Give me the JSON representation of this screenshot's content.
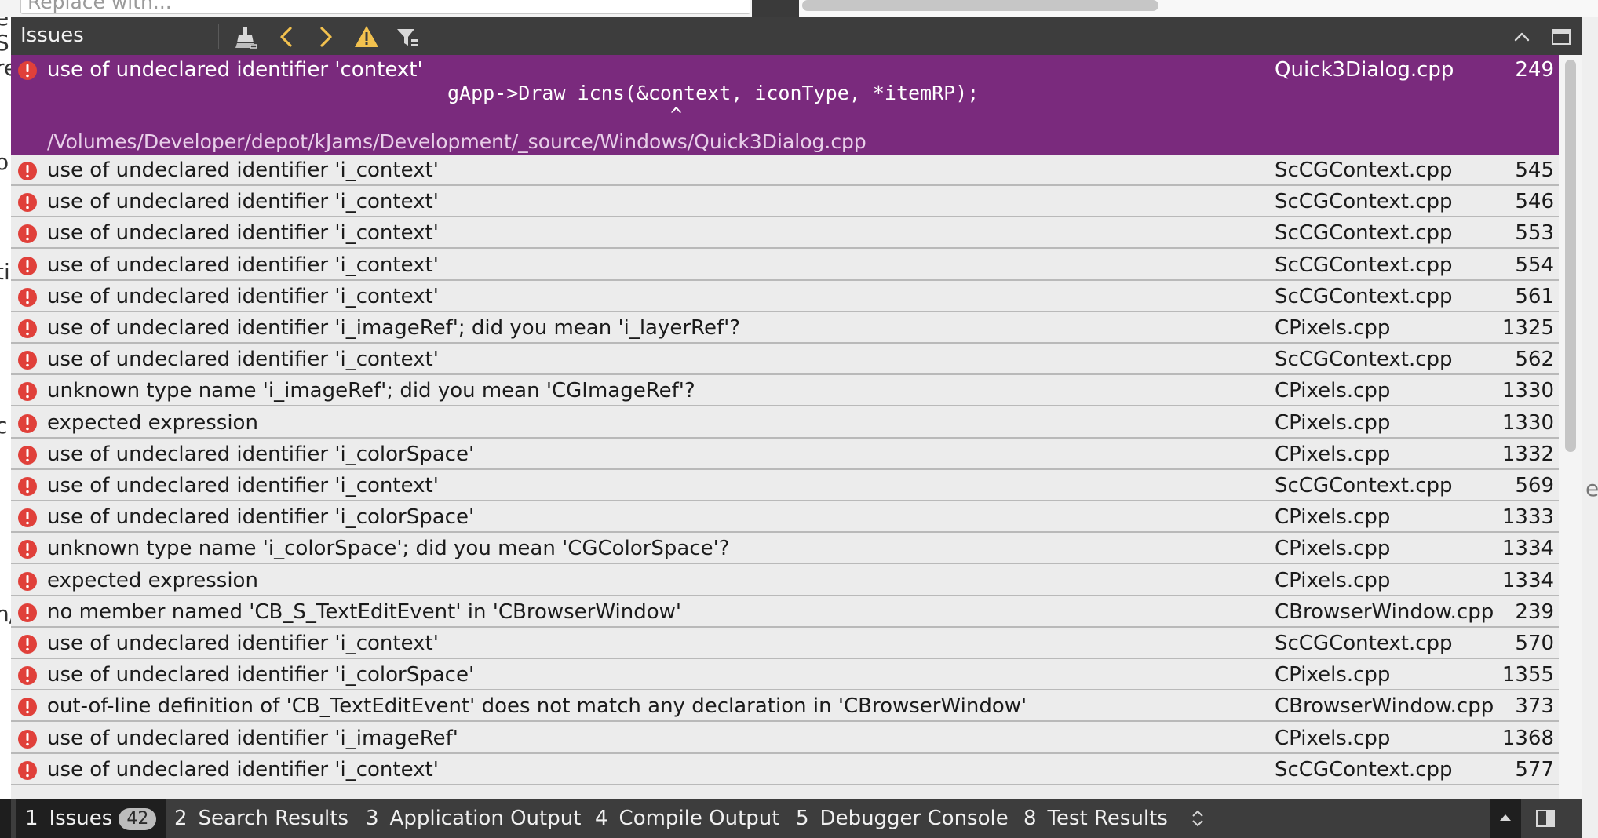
{
  "search": {
    "replace_placeholder": "Replace with..."
  },
  "issues_pane": {
    "title": "Issues",
    "selected": {
      "description": "use of undeclared identifier 'context'",
      "file": "Quick3Dialog.cpp",
      "line": "249",
      "code_line": "gApp->Draw_icns(&context, iconType, *itemRP);",
      "caret": "^",
      "path": "/Volumes/Developer/depot/kJams/Development/_source/Windows/Quick3Dialog.cpp"
    },
    "rows": [
      {
        "description": "use of undeclared identifier 'i_context'",
        "file": "ScCGContext.cpp",
        "line": "545"
      },
      {
        "description": "use of undeclared identifier 'i_context'",
        "file": "ScCGContext.cpp",
        "line": "546"
      },
      {
        "description": "use of undeclared identifier 'i_context'",
        "file": "ScCGContext.cpp",
        "line": "553"
      },
      {
        "description": "use of undeclared identifier 'i_context'",
        "file": "ScCGContext.cpp",
        "line": "554"
      },
      {
        "description": "use of undeclared identifier 'i_context'",
        "file": "ScCGContext.cpp",
        "line": "561"
      },
      {
        "description": "use of undeclared identifier 'i_imageRef'; did you mean 'i_layerRef'?",
        "file": "CPixels.cpp",
        "line": "1325"
      },
      {
        "description": "use of undeclared identifier 'i_context'",
        "file": "ScCGContext.cpp",
        "line": "562"
      },
      {
        "description": "unknown type name 'i_imageRef'; did you mean 'CGImageRef'?",
        "file": "CPixels.cpp",
        "line": "1330"
      },
      {
        "description": "expected expression",
        "file": "CPixels.cpp",
        "line": "1330"
      },
      {
        "description": "use of undeclared identifier 'i_colorSpace'",
        "file": "CPixels.cpp",
        "line": "1332"
      },
      {
        "description": "use of undeclared identifier 'i_context'",
        "file": "ScCGContext.cpp",
        "line": "569"
      },
      {
        "description": "use of undeclared identifier 'i_colorSpace'",
        "file": "CPixels.cpp",
        "line": "1333"
      },
      {
        "description": "unknown type name 'i_colorSpace'; did you mean 'CGColorSpace'?",
        "file": "CPixels.cpp",
        "line": "1334"
      },
      {
        "description": "expected expression",
        "file": "CPixels.cpp",
        "line": "1334"
      },
      {
        "description": "no member named 'CB_S_TextEditEvent' in 'CBrowserWindow'",
        "file": "CBrowserWindow.cpp",
        "line": "239"
      },
      {
        "description": "use of undeclared identifier 'i_context'",
        "file": "ScCGContext.cpp",
        "line": "570"
      },
      {
        "description": "use of undeclared identifier 'i_colorSpace'",
        "file": "CPixels.cpp",
        "line": "1355"
      },
      {
        "description": "out-of-line definition of 'CB_TextEditEvent' does not match any declaration in 'CBrowserWindow'",
        "file": "CBrowserWindow.cpp",
        "line": "373"
      },
      {
        "description": "use of undeclared identifier 'i_imageRef'",
        "file": "CPixels.cpp",
        "line": "1368"
      },
      {
        "description": "use of undeclared identifier 'i_context'",
        "file": "ScCGContext.cpp",
        "line": "577"
      }
    ]
  },
  "left_editor_fragments": [
    "e",
    "S",
    "re",
    "o",
    "ti",
    "c",
    "n/"
  ],
  "right_fragment": "e",
  "bottom_tabs": [
    {
      "num": "1",
      "label": "Issues",
      "badge": "42"
    },
    {
      "num": "2",
      "label": "Search Results"
    },
    {
      "num": "3",
      "label": "Application Output"
    },
    {
      "num": "4",
      "label": "Compile Output"
    },
    {
      "num": "5",
      "label": "Debugger Console"
    },
    {
      "num": "8",
      "label": "Test Results"
    }
  ],
  "colors": {
    "selected_row": "#7a2a7d",
    "error_icon": "#e0403a",
    "toolbar_bg": "#3d3d3d",
    "warning_icon": "#f2c14e"
  }
}
